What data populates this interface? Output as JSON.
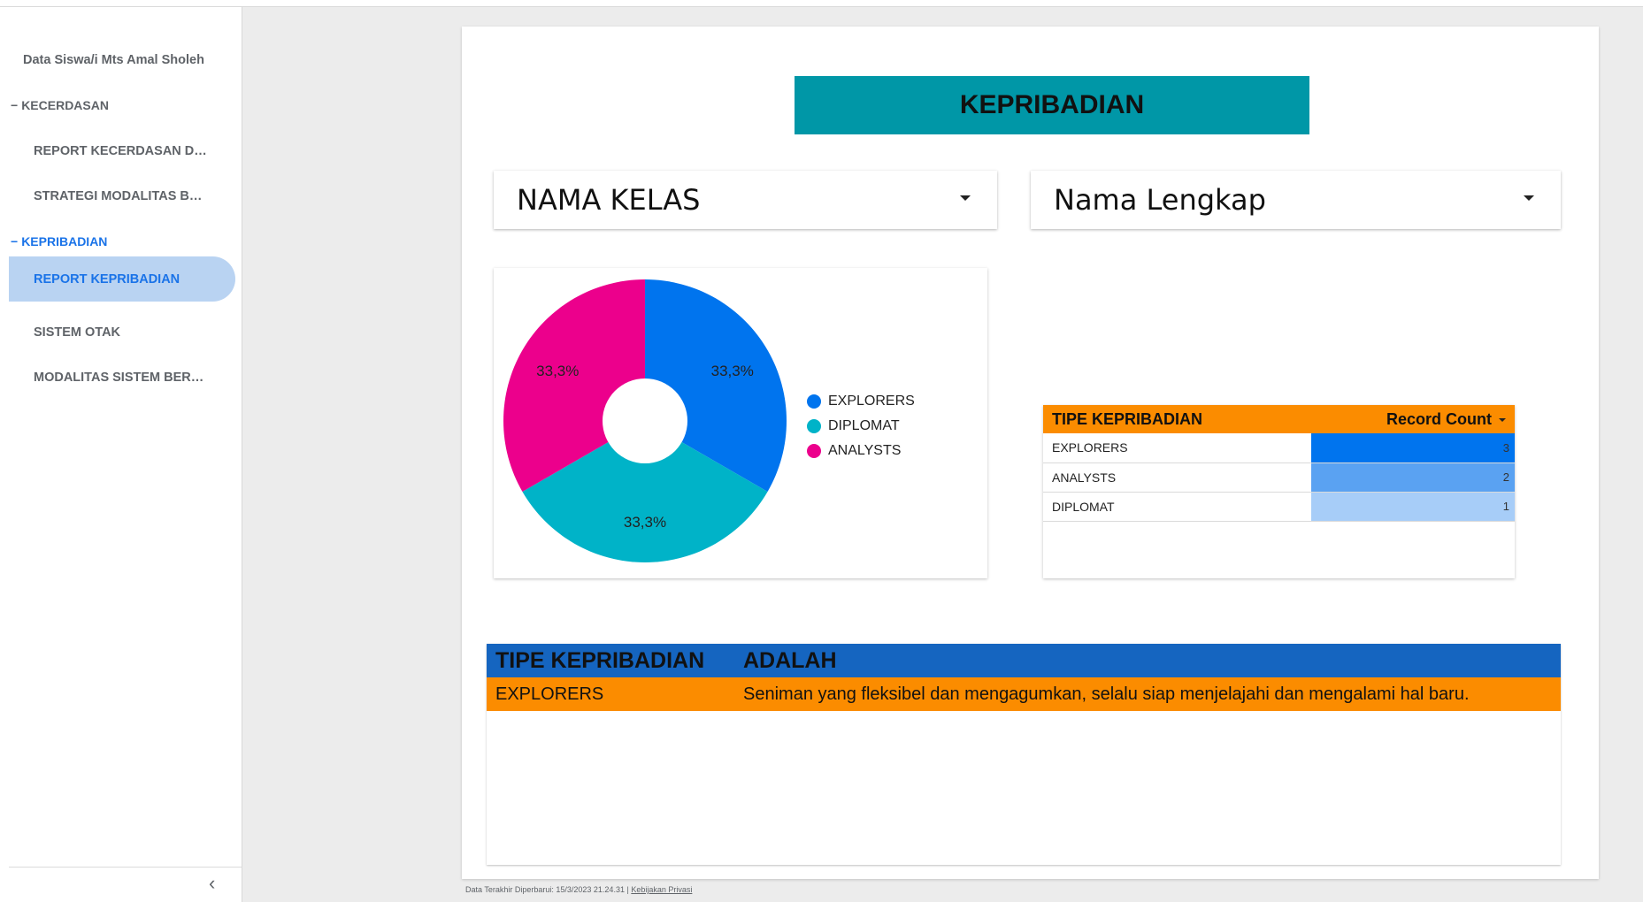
{
  "sidebar": {
    "report_title": "Data Siswa/i Mts Amal Sholeh",
    "sections": [
      {
        "label": "KECERDASAN",
        "items": [
          "REPORT KECERDASAN DAN...",
          "STRATEGI MODALITAS BEL..."
        ]
      },
      {
        "label": "KEPRIBADIAN",
        "items": [
          "REPORT KEPRIBADIAN",
          "SISTEM OTAK",
          "MODALITAS SISTEM BERFI..."
        ]
      }
    ],
    "section_marker": "−",
    "collapse_icon": "chevron-left-icon",
    "collapse_glyph": "‹"
  },
  "page": {
    "title": "KEPRIBADIAN",
    "filters": [
      {
        "label": "NAMA KELAS"
      },
      {
        "label": "Nama Lengkap"
      }
    ]
  },
  "chart_data": {
    "type": "pie",
    "donut": true,
    "labels": [
      "EXPLORERS",
      "DIPLOMAT",
      "ANALYSTS"
    ],
    "values": [
      33.3,
      33.3,
      33.3
    ],
    "value_labels": [
      "33,3%",
      "33,3%",
      "33,3%"
    ],
    "colors": [
      "#0074ee",
      "#00b3c8",
      "#ec008c"
    ],
    "legend_position": "right"
  },
  "record_table": {
    "headers": [
      "TIPE KEPRIBADIAN",
      "Record Count"
    ],
    "rows": [
      {
        "label": "EXPLORERS",
        "value": 3,
        "value_text": "3",
        "color": "#0074ee"
      },
      {
        "label": "ANALYSTS",
        "value": 2,
        "value_text": "2",
        "color": "#5aa2f2"
      },
      {
        "label": "DIPLOMAT",
        "value": 1,
        "value_text": "1",
        "color": "#a7cdf8"
      }
    ]
  },
  "desc_table": {
    "headers": [
      "TIPE KEPRIBADIAN",
      "ADALAH"
    ],
    "rows": [
      {
        "type": "EXPLORERS",
        "description": "Seniman yang fleksibel dan mengagumkan, selalu siap menjelajahi dan mengalami hal baru."
      }
    ]
  },
  "footer": {
    "updated": "Data Terakhir Diperbarui: 15/3/2023 21.24.31",
    "separator": "|",
    "privacy": "Kebijakan Privasi"
  },
  "colors": {
    "banner": "#0097a7",
    "accent_active": "#1a73e8",
    "table_header_orange": "#fb8c00",
    "table_header_blue": "#1565c0"
  }
}
